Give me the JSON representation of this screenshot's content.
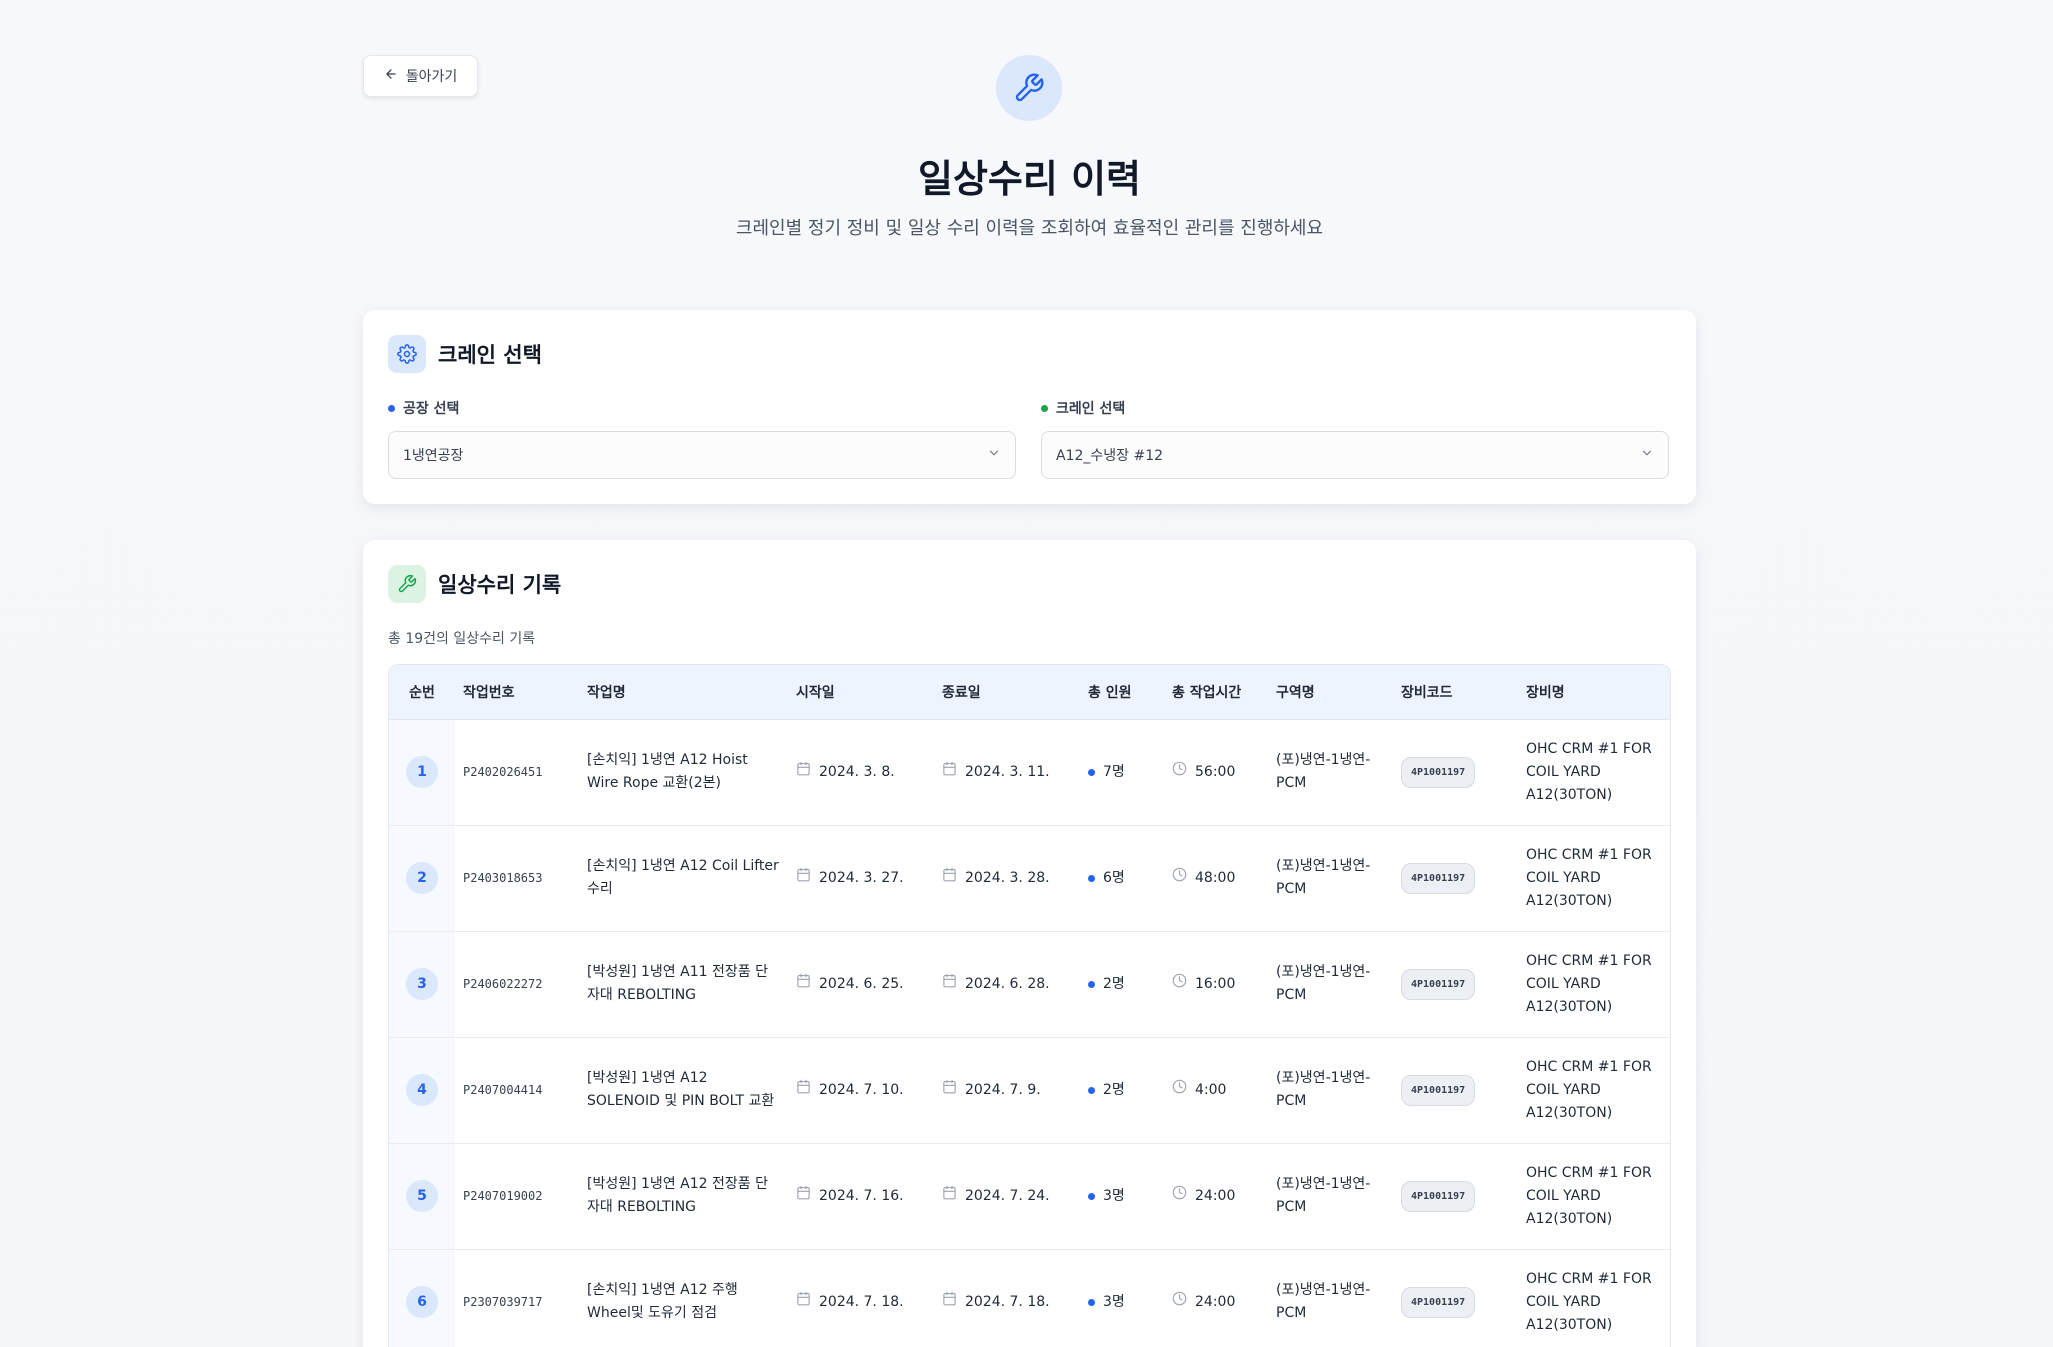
{
  "nav": {
    "back_label": "돌아가기"
  },
  "header": {
    "title": "일상수리 이력",
    "subtitle": "크레인별 정기 정비 및 일상 수리 이력을 조회하여 효율적인 관리를 진행하세요"
  },
  "crane_select": {
    "title": "크레인 선택",
    "factory_label": "공장 선택",
    "factory_value": "1냉연공장",
    "crane_label": "크레인 선택",
    "crane_value": "A12_수냉장 #12"
  },
  "records": {
    "title": "일상수리 기록",
    "count_text": "총 19건의 일상수리 기록",
    "columns": [
      "순번",
      "작업번호",
      "작업명",
      "시작일",
      "종료일",
      "총 인원",
      "총 작업시간",
      "구역명",
      "장비코드",
      "장비명"
    ],
    "rows": [
      {
        "no": "1",
        "job_no": "P2402026451",
        "job_name": "[손치익] 1냉연 A12 Hoist Wire Rope 교환(2본)",
        "start": "2024. 3. 8.",
        "end": "2024. 3. 11.",
        "people": "7명",
        "hours": "56:00",
        "area": "(포)냉연-1냉연-PCM",
        "code": "4P1001197",
        "equip": "OHC CRM #1 FOR COIL YARD A12(30TON)"
      },
      {
        "no": "2",
        "job_no": "P2403018653",
        "job_name": "[손치익] 1냉연 A12 Coil Lifter 수리",
        "start": "2024. 3. 27.",
        "end": "2024. 3. 28.",
        "people": "6명",
        "hours": "48:00",
        "area": "(포)냉연-1냉연-PCM",
        "code": "4P1001197",
        "equip": "OHC CRM #1 FOR COIL YARD A12(30TON)"
      },
      {
        "no": "3",
        "job_no": "P2406022272",
        "job_name": "[박성원] 1냉연 A11 전장품 단자대 REBOLTING",
        "start": "2024. 6. 25.",
        "end": "2024. 6. 28.",
        "people": "2명",
        "hours": "16:00",
        "area": "(포)냉연-1냉연-PCM",
        "code": "4P1001197",
        "equip": "OHC CRM #1 FOR COIL YARD A12(30TON)"
      },
      {
        "no": "4",
        "job_no": "P2407004414",
        "job_name": "[박성원] 1냉연 A12 SOLENOID 및 PIN BOLT 교환",
        "start": "2024. 7. 10.",
        "end": "2024. 7. 9.",
        "people": "2명",
        "hours": "4:00",
        "area": "(포)냉연-1냉연-PCM",
        "code": "4P1001197",
        "equip": "OHC CRM #1 FOR COIL YARD A12(30TON)"
      },
      {
        "no": "5",
        "job_no": "P2407019002",
        "job_name": "[박성원] 1냉연 A12 전장품 단자대 REBOLTING",
        "start": "2024. 7. 16.",
        "end": "2024. 7. 24.",
        "people": "3명",
        "hours": "24:00",
        "area": "(포)냉연-1냉연-PCM",
        "code": "4P1001197",
        "equip": "OHC CRM #1 FOR COIL YARD A12(30TON)"
      },
      {
        "no": "6",
        "job_no": "P2307039717",
        "job_name": "[손치익] 1냉연 A12 주행 Wheel및 도유기 점검",
        "start": "2024. 7. 18.",
        "end": "2024. 7. 18.",
        "people": "3명",
        "hours": "24:00",
        "area": "(포)냉연-1냉연-PCM",
        "code": "4P1001197",
        "equip": "OHC CRM #1 FOR COIL YARD A12(30TON)"
      }
    ]
  },
  "colors": {
    "accent_blue": "#2563eb",
    "accent_green": "#16a34a",
    "icon_bg_blue": "#dbe7fb",
    "icon_bg_green": "#dcf3e4"
  },
  "icons": {
    "back": "arrow-left-icon",
    "hero": "wrench-icon",
    "crane_select": "gear-icon",
    "records": "wrench-icon",
    "dropdown": "chevron-down-icon",
    "date": "calendar-icon",
    "time": "clock-icon"
  }
}
